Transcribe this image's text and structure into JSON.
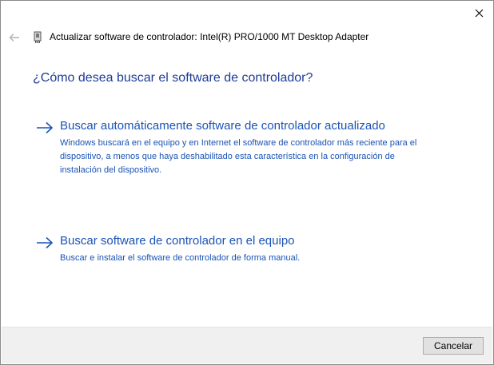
{
  "window": {
    "title": "Actualizar software de controlador: Intel(R) PRO/1000 MT Desktop Adapter"
  },
  "icons": {
    "close": "close-icon",
    "back": "back-arrow-icon",
    "device": "network-adapter-icon",
    "option_arrow": "arrow-right-icon"
  },
  "main": {
    "question": "¿Cómo desea buscar el software de controlador?",
    "options": [
      {
        "title": "Buscar automáticamente software de controlador actualizado",
        "description": "Windows buscará en el equipo y en Internet el software de controlador más reciente para el dispositivo, a menos que haya deshabilitado esta característica en la configuración de instalación del dispositivo."
      },
      {
        "title": "Buscar software de controlador en el equipo",
        "description": "Buscar e instalar el software de controlador de forma manual."
      }
    ]
  },
  "footer": {
    "cancel_label": "Cancelar"
  },
  "colors": {
    "link": "#1a53b4",
    "heading": "#1e3c96",
    "footer_bg": "#f0f0f0"
  }
}
